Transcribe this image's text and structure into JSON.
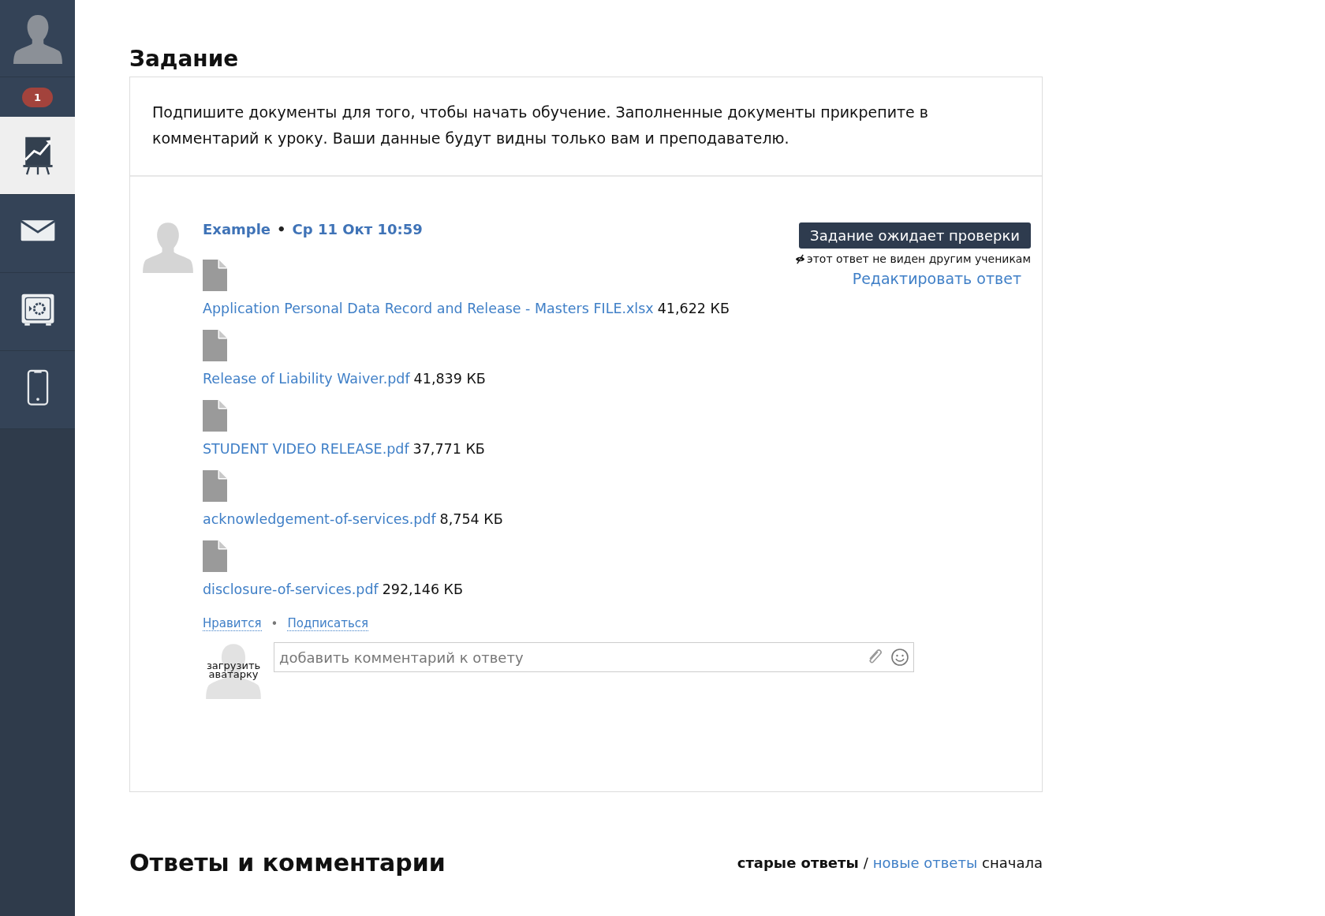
{
  "sidebar": {
    "badge": "1",
    "items": [
      {
        "kind": "chart",
        "selected": true
      },
      {
        "kind": "mail",
        "selected": false
      },
      {
        "kind": "safe",
        "selected": false
      },
      {
        "kind": "phone",
        "selected": false
      }
    ]
  },
  "task": {
    "title": "Задание",
    "text": "Подпишите документы для того, чтобы начать обучение. Заполненные документы прикрепите в комментарий к уроку. Ваши данные будут видны только вам и преподавателю."
  },
  "answer": {
    "author": "Example",
    "separator": "•",
    "date": "Ср 11 Окт 10:59",
    "status": "Задание ожидает проверки",
    "visibility_note": "этот ответ не виден другим ученикам",
    "edit_link": "Редактировать ответ",
    "files": [
      {
        "name": "Application Personal Data Record and Release - Masters FILE.xlsx",
        "size": "41,622 КБ"
      },
      {
        "name": "Release of Liability Waiver.pdf",
        "size": "41,839 КБ"
      },
      {
        "name": "STUDENT VIDEO RELEASE.pdf",
        "size": "37,771 КБ"
      },
      {
        "name": "acknowledgement-of-services.pdf",
        "size": "8,754 КБ"
      },
      {
        "name": "disclosure-of-services.pdf",
        "size": "292,146 КБ"
      }
    ],
    "actions": [
      "Нравится",
      "Подписаться"
    ],
    "actions_separator": "•",
    "comment": {
      "avatar_label": "загрузить аватарку",
      "placeholder": "добавить комментарий к ответу"
    }
  },
  "replies": {
    "title": "Ответы и комментарии",
    "sort_options": [
      {
        "label": "старые ответы",
        "selected": true
      },
      {
        "label": "новые ответы",
        "selected": false
      }
    ],
    "sort_separator": "/",
    "sort_suffix": "сначала"
  }
}
